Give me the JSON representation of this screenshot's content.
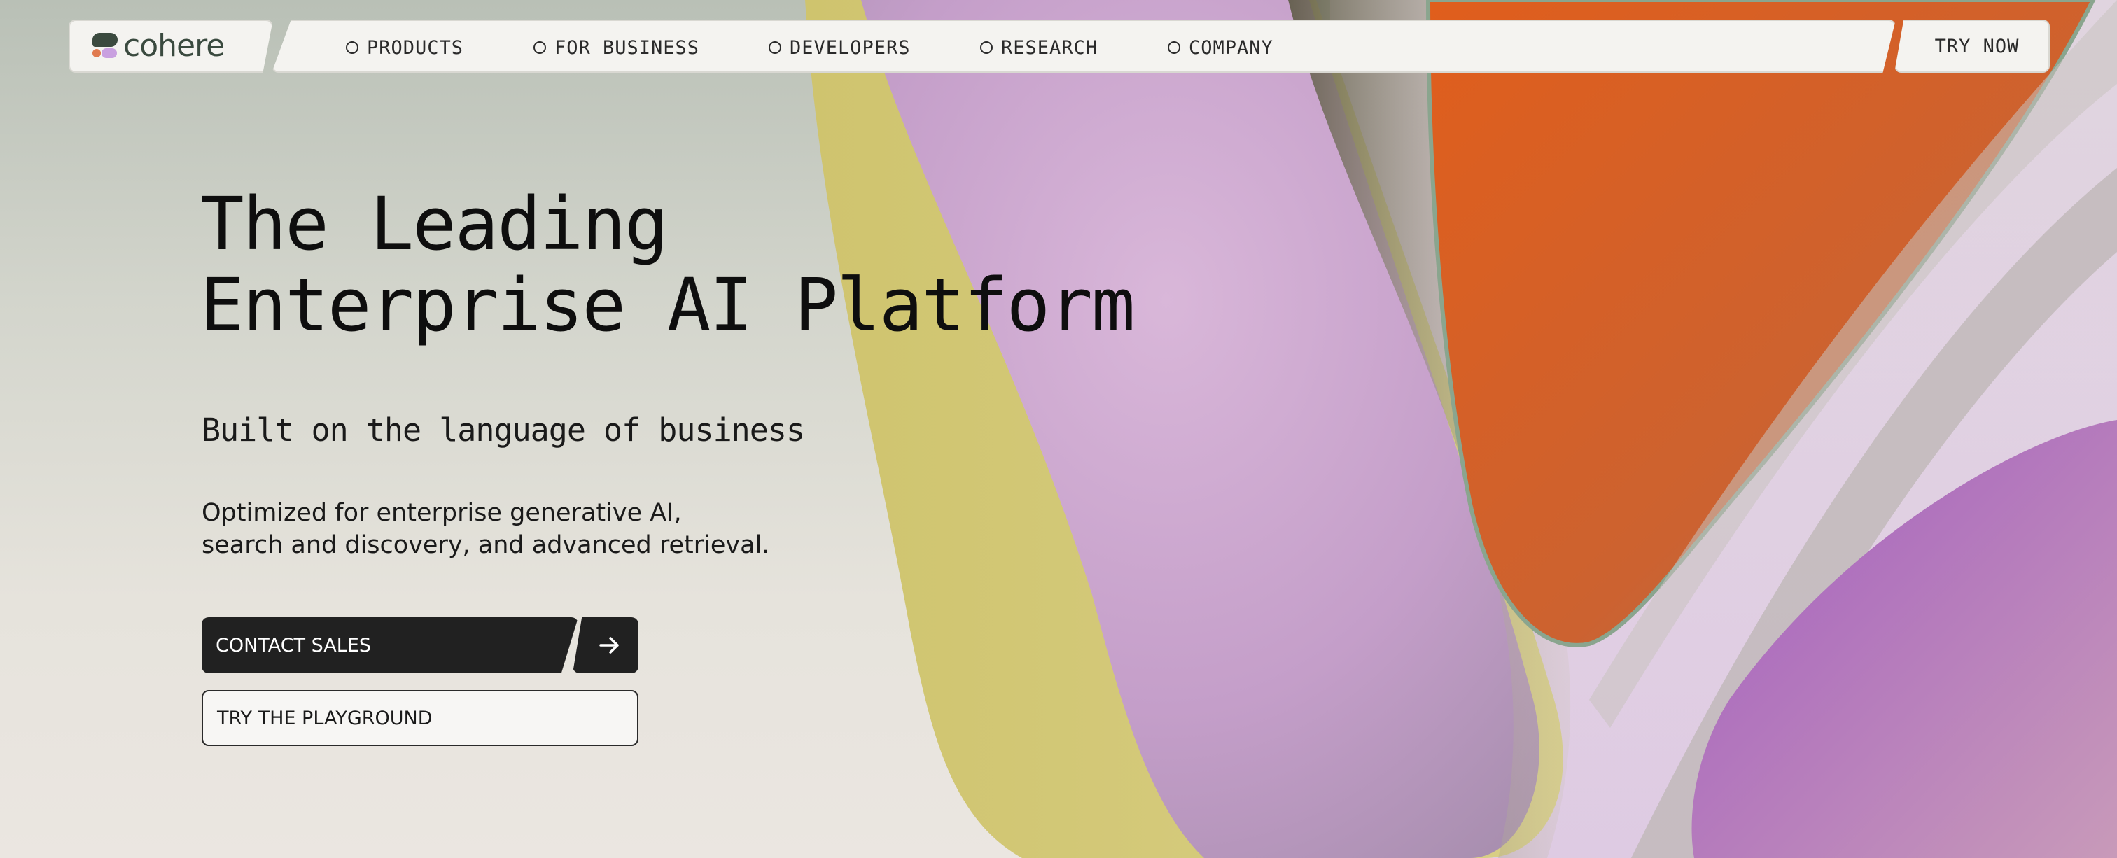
{
  "brand": {
    "name": "cohere"
  },
  "nav": {
    "items": [
      {
        "label": "PRODUCTS"
      },
      {
        "label": "FOR BUSINESS"
      },
      {
        "label": "DEVELOPERS"
      },
      {
        "label": "RESEARCH"
      },
      {
        "label": "COMPANY"
      }
    ],
    "cta_label": "TRY NOW"
  },
  "hero": {
    "title_line1": "The Leading",
    "title_line2": "Enterprise AI Platform",
    "subtitle": "Built on the language of business",
    "desc_line1": "Optimized for enterprise generative AI,",
    "desc_line2": "search and discovery, and advanced retrieval.",
    "primary_button": "CONTACT SALES",
    "primary_button_icon": "arrow-right-icon",
    "secondary_button": "TRY THE PLAYGROUND"
  },
  "colors": {
    "nav_bg": "#f4f3f0",
    "button_dark": "#212121",
    "shape_orange": "#d5602a",
    "shape_lilac": "#c9a0d2",
    "shape_yellow": "#d2c77a",
    "shape_purple": "#b478c8"
  }
}
